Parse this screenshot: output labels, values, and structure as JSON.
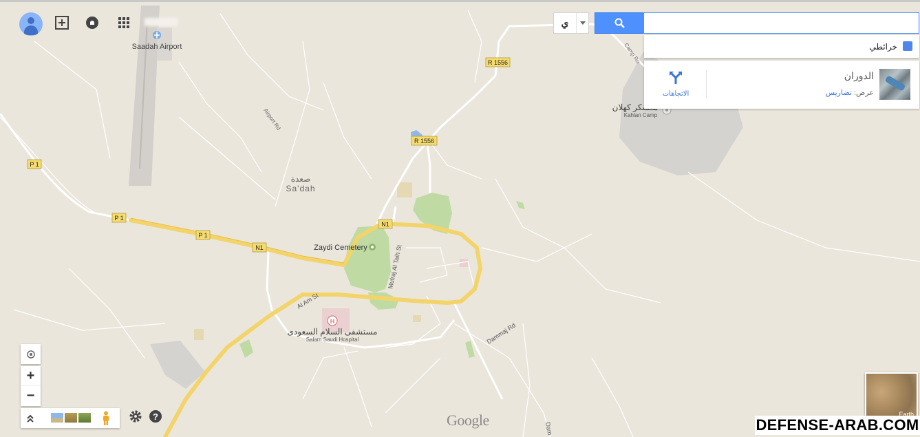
{
  "toolbar": {
    "icons": [
      "account-avatar-icon",
      "add-place-icon",
      "notifications-icon",
      "apps-grid-icon"
    ]
  },
  "search": {
    "language_label": "ي",
    "input_value": "",
    "suggestion_label": "خرائطي",
    "result": {
      "name": "الدوران",
      "view_prefix": "عرض:",
      "view_link": "تضاريس",
      "directions_label": "الاتجاهات"
    }
  },
  "map": {
    "labels": {
      "airport": "Saadah Airport",
      "airport_rd": "Airport Rd",
      "city_ar": "صعدة",
      "city_en": "Sa'dah",
      "cemetery": "Zaydi Cemetery",
      "mufraj": "Mufraj Al Taih St",
      "al_am": "Al Am St",
      "hospital_ar": "مستشفى السلام السعودى",
      "hospital_en": "Salam Saudi Hospital",
      "dammaj": "Dammaj Rd",
      "dammaj_cut": "Dam",
      "camp_road": "Camp Ro",
      "kahlan_ar": "معسكر كهلان",
      "kahlan_en": "Kahlan Camp"
    },
    "shields": {
      "r1556": "R 1556",
      "p1": "P 1",
      "n1": "N1"
    }
  },
  "controls": {
    "zoom_in": "+",
    "zoom_out": "−"
  },
  "earth_label": "Earth",
  "brand": "Google",
  "watermark": "DEFENSE-ARAB.COM"
}
